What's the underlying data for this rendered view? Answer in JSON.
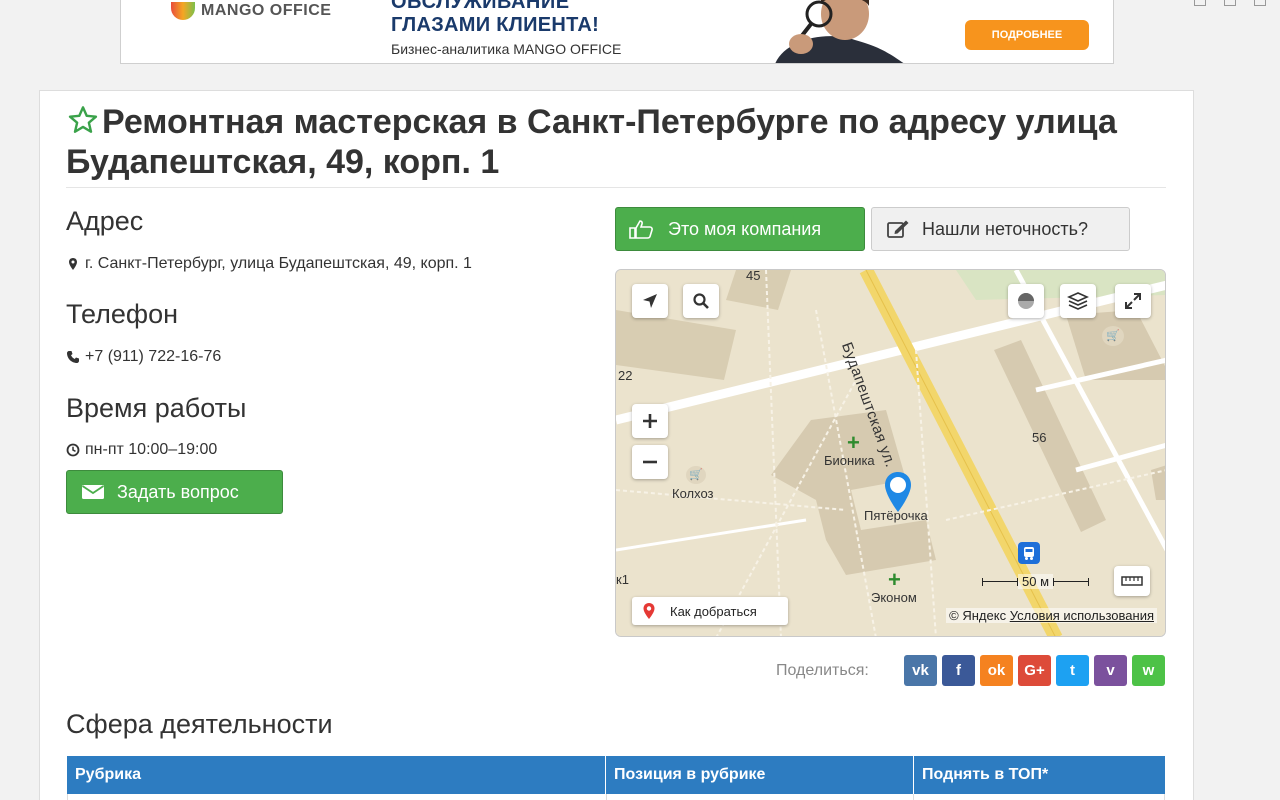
{
  "banner": {
    "logo_text": "MANGO OFFICE",
    "headline_top": "ОБСЛУЖИВАНИЕ",
    "headline": "ГЛАЗАМИ КЛИЕНТА!",
    "subtitle": "Бизнес-аналитика MANGO OFFICE",
    "button_label": "ПОДРОБНЕЕ"
  },
  "page": {
    "title": "Ремонтная мастерская в Санкт-Петербурге по адресу улица Будапештская, 49, корп. 1"
  },
  "contacts": {
    "address_heading": "Адрес",
    "address": "г. Санкт-Петербург, улица Будапештская, 49, корп. 1",
    "phone_heading": "Телефон",
    "phone": "+7 (911) 722-16-76",
    "hours_heading": "Время работы",
    "hours": "пн-пт 10:00–19:00",
    "ask_button": "Задать вопрос"
  },
  "actions": {
    "my_company": "Это моя компания",
    "inaccuracy": "Нашли неточность?"
  },
  "map": {
    "street_label": "Будапештская ул.",
    "places": [
      "Бионика",
      "Колхоз",
      "Пятёрочка",
      "Эконом"
    ],
    "house_numbers": [
      "45",
      "22",
      "56",
      "к1"
    ],
    "route_button": "Как добраться",
    "scale": "50 м",
    "copyright": "© Яндекс",
    "terms_link": "Условия использования"
  },
  "share": {
    "label": "Поделиться:",
    "buttons": [
      {
        "name": "vk",
        "glyph": "vk",
        "color": "#4a76a8"
      },
      {
        "name": "facebook",
        "glyph": "f",
        "color": "#3b5998"
      },
      {
        "name": "odnoklassniki",
        "glyph": "ok",
        "color": "#f58220"
      },
      {
        "name": "google-plus",
        "glyph": "G+",
        "color": "#dd4b39"
      },
      {
        "name": "twitter",
        "glyph": "t",
        "color": "#1da1f2"
      },
      {
        "name": "viber",
        "glyph": "v",
        "color": "#7b519d"
      },
      {
        "name": "whatsapp",
        "glyph": "w",
        "color": "#4dc247"
      }
    ]
  },
  "activity": {
    "heading": "Сфера деятельности",
    "columns": [
      "Рубрика",
      "Позиция в рубрике",
      "Поднять в ТОП*"
    ]
  }
}
